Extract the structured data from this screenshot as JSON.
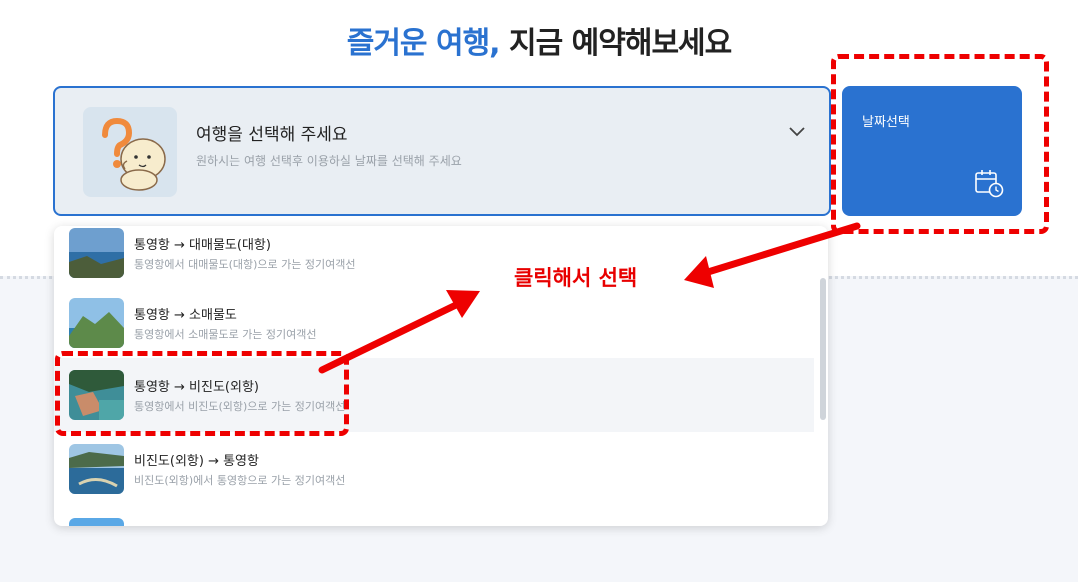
{
  "headline": {
    "accent": "즐거운 여행,",
    "rest": "지금 예약해보세요"
  },
  "selector": {
    "title": "여행을 선택해 주세요",
    "subtitle": "원하시는 여행 선택후 이용하실 날짜를 선택해 주세요"
  },
  "date_button": {
    "label": "날짜선택"
  },
  "routes": [
    {
      "title": "통영항 → 대매물도(대항)",
      "desc": "통영항에서 대매물도(대항)으로 가는 정기여객선"
    },
    {
      "title": "통영항 → 소매물도",
      "desc": "통영항에서 소매물도로 가는 정기여객선"
    },
    {
      "title": "통영항 → 비진도(외항)",
      "desc": "통영항에서 비진도(외항)으로 가는 정기여객선"
    },
    {
      "title": "비진도(외항) → 통영항",
      "desc": "비진도(외항)에서 통영항으로 가는 정기여객선"
    }
  ],
  "annotation": {
    "text": "클릭해서 선택"
  },
  "colors": {
    "accent": "#2a72d0",
    "annotation": "#ee0000"
  },
  "icons": {
    "dropdown": "chevron-down-icon",
    "date": "calendar-clock-icon"
  }
}
